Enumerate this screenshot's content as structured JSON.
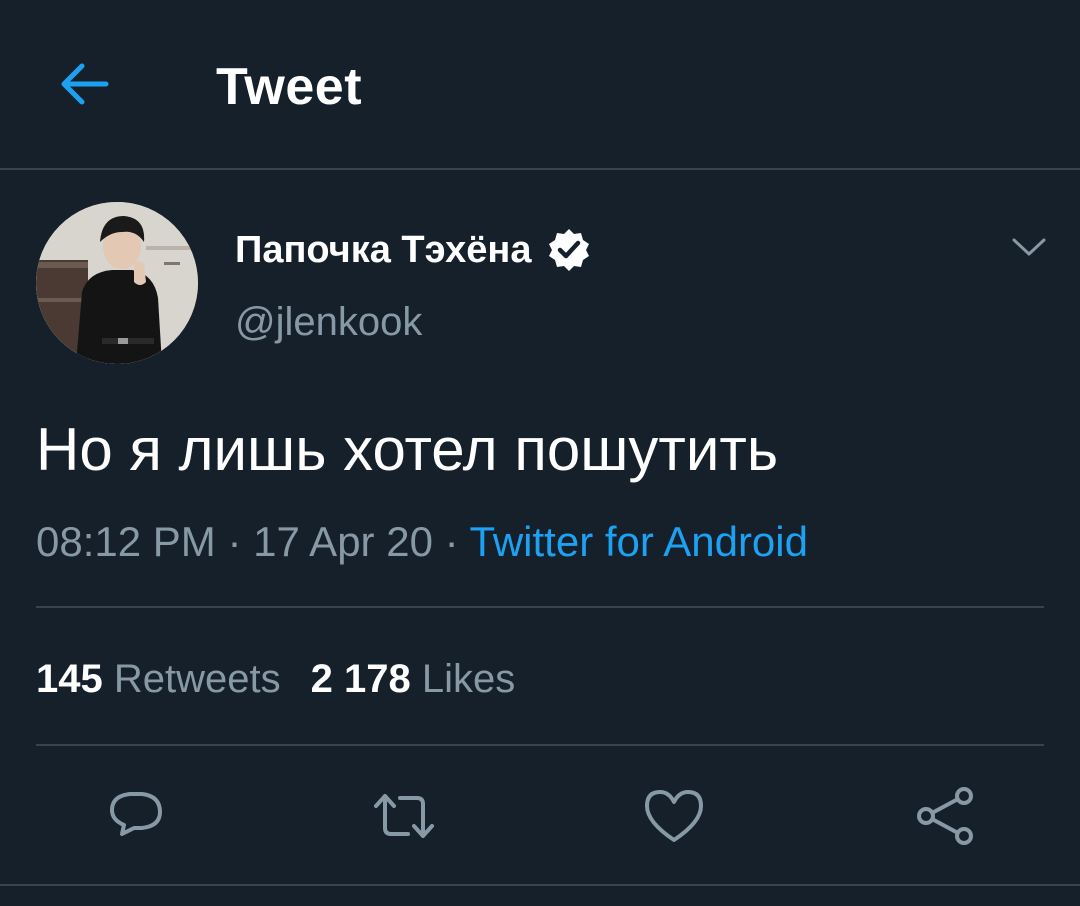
{
  "header": {
    "title": "Tweet",
    "back_icon": "arrow-left-icon",
    "accent_color": "#1da1f2"
  },
  "author": {
    "display_name": "Папочка Тэхёна",
    "handle": "@jlenkook",
    "verified": true,
    "avatar_icon": "profile-photo"
  },
  "tweet": {
    "text": "Но я лишь хотел пошутить",
    "time": "08:12 PM",
    "date": "17 Apr 20",
    "separator": " · ",
    "source": "Twitter for Android"
  },
  "stats": {
    "retweets_count": "145",
    "retweets_label": "Retweets",
    "likes_count": "2 178",
    "likes_label": "Likes"
  },
  "actions": {
    "icons": [
      "reply-icon",
      "retweet-icon",
      "like-icon",
      "share-icon"
    ]
  },
  "colors": {
    "background": "#15202b",
    "text": "#ffffff",
    "secondary": "#8899a6",
    "divider": "#38444d",
    "link": "#1da1f2"
  }
}
